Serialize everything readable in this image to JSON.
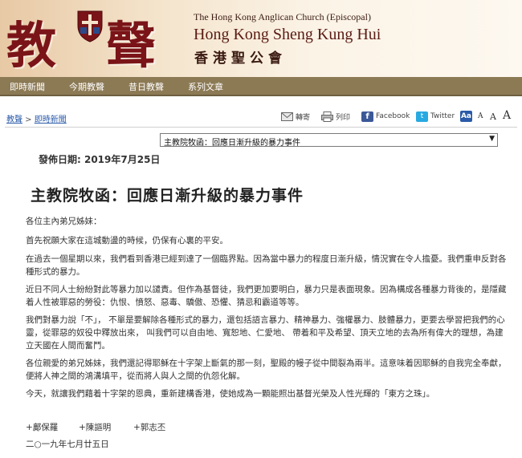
{
  "header": {
    "logo_char_1": "教",
    "logo_char_2": "聲",
    "church_en_1": "The Hong Kong Anglican Church (Episcopal)",
    "church_en_2": "Hong Kong Sheng Kung Hui",
    "church_zh": "香港聖公會"
  },
  "nav": {
    "items": [
      {
        "label": "即時新聞"
      },
      {
        "label": "今期教聲"
      },
      {
        "label": "昔日教聲"
      },
      {
        "label": "系列文章"
      }
    ]
  },
  "breadcrumb": {
    "home": "教聲",
    "separator": " > ",
    "current": "即時新聞"
  },
  "share": {
    "email": "轉寄",
    "print": "列印",
    "facebook": "Facebook",
    "twitter": "Twitter",
    "font_small": "A",
    "font_medium": "A",
    "font_large": "A"
  },
  "article_select": {
    "selected": "主教院牧函：回應日漸升級的暴力事件"
  },
  "article": {
    "date_label": "發佈日期: 2019年7月25日",
    "title": "主教院牧函：回應日漸升級的暴力事件",
    "paragraphs": [
      "各位主內弟兄姊妹：",
      "首先祝願大家在這城動盪的時候，仍保有心裏的平安。",
      "在過去一個星期以來，我們看到香港已經到達了一個臨界點。因為當中暴力的程度日漸升級，情況實在令人擔憂。我們重申反對各種形式的暴力。",
      "近日不同人士紛紛對此等暴力加以譴責。但作為基督徒，我們更加要明白，暴力只是表面現象。因為構成各種暴力背後的，是隱藏着人性被罪惡的勞役：仇恨、憤怒、惡毒、驕傲、恐懼、猜忌和霸道等等。",
      "我們對暴力說「不」， 不單是要解除各種形式的暴力，還包括語言暴力、精神暴力、強權暴力、肢體暴力，更要去學習把我們的心靈，從罪惡的奴役中釋放出來， 叫我們可以自由地、寬恕地、仁愛地、 帶着和平及希望、頂天立地的去為所有偉大的理想，為建立天國在人間而奮鬥。",
      "各位親愛的弟兄姊妹，我們還記得耶穌在十字架上斷氣的那一刻，聖殿的幔子從中間裂為兩半。這意味着因耶穌的自我完全奉獻，便將人神之間的鴻溝填平，從而將人與人之間的仇怨化解。",
      "今天，就讓我們藉着十字架的恩典，重新建構香港，使她成為一顆能照出基督光榮及人性光輝的「東方之珠」。"
    ],
    "signatures": [
      "+鄺保羅",
      "+陳謳明",
      "+郭志丕"
    ],
    "sign_date": "二○一九年七月廿五日"
  },
  "colors": {
    "nav_bg": "#8c7a55",
    "logo_red": "#7a1418",
    "link_blue": "#2a5aa8"
  }
}
